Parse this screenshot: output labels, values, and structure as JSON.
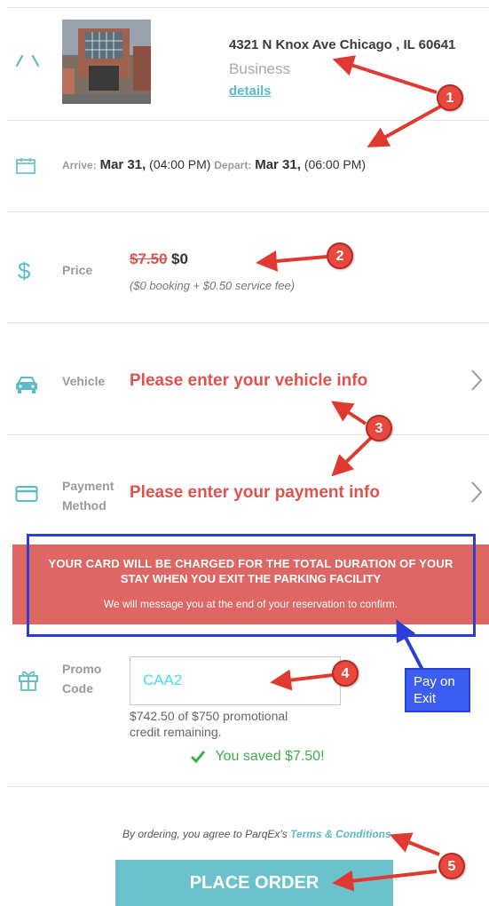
{
  "location": {
    "address": "4321 N Knox Ave Chicago , IL 60641",
    "type": "Business",
    "details_link": "details"
  },
  "schedule": {
    "arrive_label": "Arrive:",
    "arrive_date": "Mar 31,",
    "arrive_time": "(04:00 PM)",
    "depart_label": "Depart:",
    "depart_date": "Mar 31,",
    "depart_time": "(06:00 PM)"
  },
  "price": {
    "label": "Price",
    "original": "$7.50",
    "current": "$0",
    "breakdown": "($0 booking + $0.50 service fee)"
  },
  "vehicle": {
    "label": "Vehicle",
    "prompt": "Please enter your vehicle info"
  },
  "payment": {
    "label_line1": "Payment",
    "label_line2": "Method",
    "prompt": "Please enter your payment info"
  },
  "banner": {
    "line1": "YOUR CARD WILL BE CHARGED FOR THE TOTAL DURATION OF YOUR",
    "line2": "STAY WHEN YOU EXIT THE PARKING FACILITY",
    "sub": "We will message you at the end of your reservation to confirm.",
    "bg_color": "#de6663"
  },
  "promo": {
    "label_line1": "Promo",
    "label_line2": "Code",
    "code_value": "CAA2",
    "credit_line1": "$742.50 of $750 promotional",
    "credit_line2": "credit remaining.",
    "saved": "You saved $7.50!"
  },
  "terms": {
    "prefix": "By ordering, you agree to ParqEx's ",
    "link": "Terms & Conditions"
  },
  "order_button": {
    "label": "PLACE ORDER",
    "color": "#6cc2cc"
  },
  "annotations": {
    "callouts": [
      "1",
      "2",
      "3",
      "4",
      "5"
    ],
    "pay_on_exit_line1": "Pay on",
    "pay_on_exit_line2": "Exit"
  },
  "icons": [
    "direction-arrows-icon",
    "calendar-icon",
    "dollar-icon",
    "car-icon",
    "credit-card-icon",
    "gift-icon",
    "checkmark-icon",
    "chevron-right-icon"
  ]
}
